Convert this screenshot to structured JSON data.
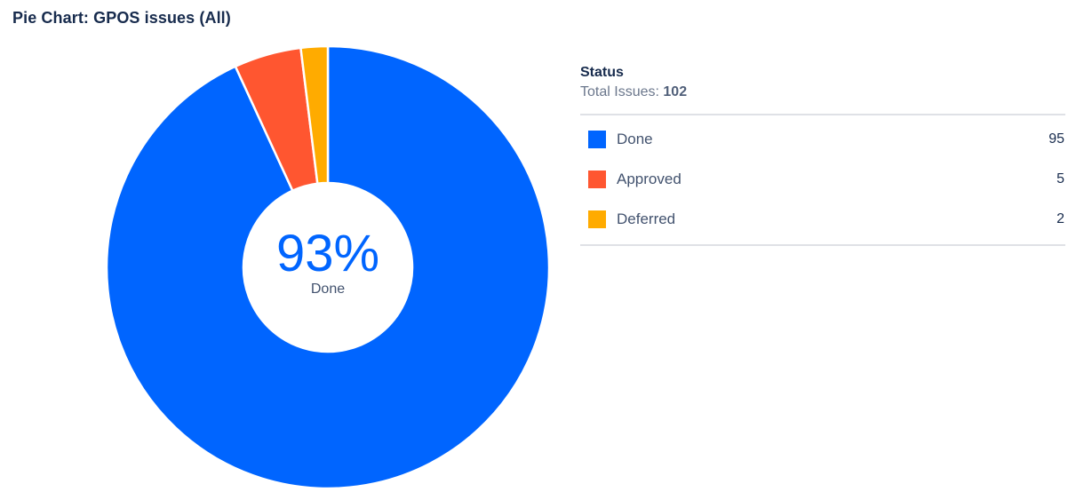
{
  "title": "Pie Chart: GPOS issues (All)",
  "center": {
    "percent": "93%",
    "label": "Done"
  },
  "legend": {
    "heading": "Status",
    "total_label": "Total Issues:",
    "total_value": "102",
    "items": [
      {
        "label": "Done",
        "count": "95",
        "color": "#0065ff"
      },
      {
        "label": "Approved",
        "count": "5",
        "color": "#ff5630"
      },
      {
        "label": "Deferred",
        "count": "2",
        "color": "#ffab00"
      }
    ]
  },
  "chart_data": {
    "type": "pie",
    "title": "Pie Chart: GPOS issues (All)",
    "legend_title": "Status",
    "categories": [
      "Done",
      "Approved",
      "Deferred"
    ],
    "values": [
      95,
      5,
      2
    ],
    "colors": [
      "#0065ff",
      "#ff5630",
      "#ffab00"
    ],
    "total": 102,
    "donut": true,
    "legend_placement": "right"
  }
}
